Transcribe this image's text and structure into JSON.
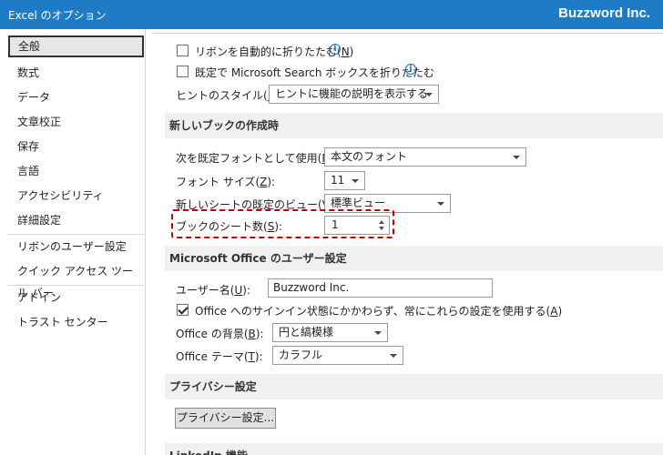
{
  "window": {
    "title": "Excel のオプション",
    "brand": "Buzzword Inc."
  },
  "sidebar": {
    "items": [
      {
        "label": "全般",
        "selected": true
      },
      {
        "label": "数式"
      },
      {
        "label": "データ"
      },
      {
        "label": "文章校正"
      },
      {
        "label": "保存"
      },
      {
        "label": "言語"
      },
      {
        "label": "アクセシビリティ"
      },
      {
        "label": "詳細設定"
      },
      {
        "label": "リボンのユーザー設定"
      },
      {
        "label": "クイック アクセス ツール バー"
      },
      {
        "label": "アドイン"
      },
      {
        "label": "トラスト センター"
      }
    ]
  },
  "ui_options": {
    "collapse_ribbon": {
      "label": "リボンを自動的に折りたたむ(",
      "key": "N",
      "suffix": ")",
      "checked": false
    },
    "collapse_search": {
      "label": "既定で Microsoft Search ボックスを折りたたむ",
      "checked": false
    },
    "tooltip_style": {
      "label": "ヒントのスタイル(",
      "key": "R",
      "suffix": "):",
      "value": "ヒントに機能の説明を表示する"
    },
    "info_glyph": "i"
  },
  "new_workbook": {
    "header": "新しいブックの作成時",
    "default_font": {
      "label": "次を既定フォントとして使用(",
      "key": "N",
      "suffix": "):",
      "value": "本文のフォント"
    },
    "font_size": {
      "label": "フォント サイズ(",
      "key": "Z",
      "suffix": "):",
      "value": "11"
    },
    "default_view": {
      "label": "新しいシートの既定のビュー(",
      "key": "V",
      "suffix": "):",
      "value": "標準ビュー"
    },
    "sheet_count": {
      "label": "ブックのシート数(",
      "key": "S",
      "suffix": "):",
      "value": "1"
    }
  },
  "personalize": {
    "header": "Microsoft Office のユーザー設定",
    "username": {
      "label": "ユーザー名(",
      "key": "U",
      "suffix": "):",
      "value": "Buzzword Inc."
    },
    "always_use": {
      "label": "Office へのサインイン状態にかかわらず、常にこれらの設定を使用する(",
      "key": "A",
      "suffix": ")",
      "checked": true
    },
    "background": {
      "label": "Office の背景(",
      "key": "B",
      "suffix": "):",
      "value": "円と縞模様"
    },
    "theme": {
      "label": "Office テーマ(",
      "key": "T",
      "suffix": "):",
      "value": "カラフル"
    }
  },
  "privacy": {
    "header": "プライバシー設定",
    "button": "プライバシー設定..."
  },
  "linkedin": {
    "header": "LinkedIn 機能"
  },
  "colors": {
    "titlebar": "#1f7bc5",
    "highlight": "#c00000",
    "section_bg": "#f0f0f0"
  }
}
